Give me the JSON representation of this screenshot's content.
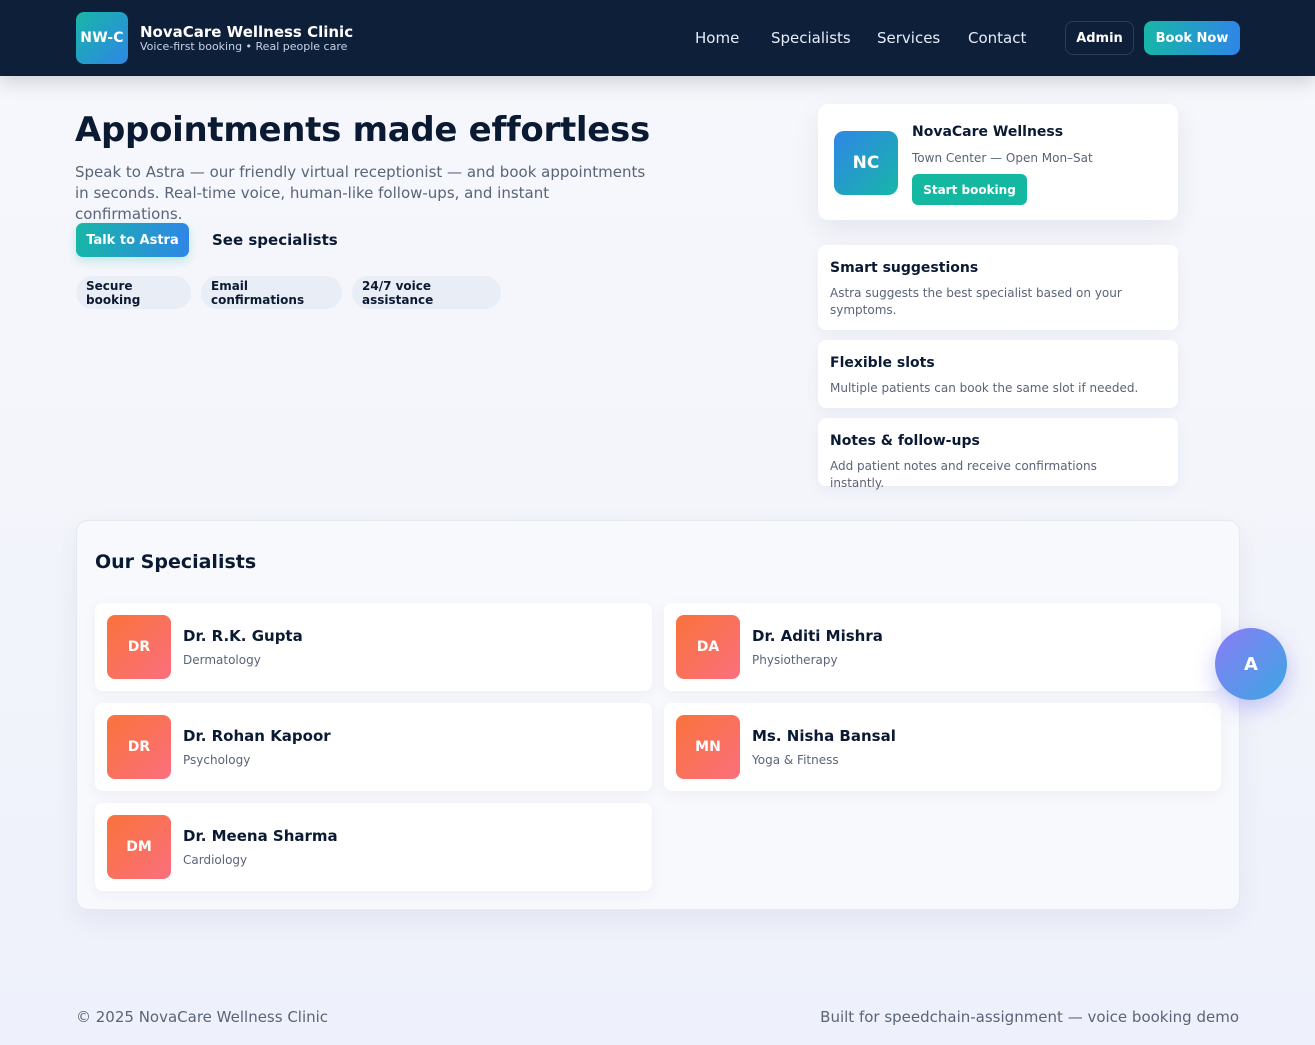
{
  "header": {
    "logo_text": "NW-C",
    "brand_name": "NovaCare Wellness Clinic",
    "brand_tagline": "Voice-first booking • Real people care",
    "nav": [
      "Home",
      "Specialists",
      "Services",
      "Contact"
    ],
    "admin_label": "Admin",
    "book_label": "Book Now"
  },
  "hero": {
    "title": "Appointments made effortless",
    "subtitle": "Speak to Astra — our friendly virtual receptionist — and book appointments in seconds. Real-time voice, human-like follow-ups, and instant confirmations.",
    "talk_label": "Talk to Astra",
    "specialists_link": "See specialists",
    "pills": [
      "Secure booking",
      "Email confirmations",
      "24/7 voice assistance"
    ]
  },
  "clinic_card": {
    "initials": "NC",
    "name": "NovaCare Wellness",
    "location": "Town Center — Open Mon–Sat",
    "start_label": "Start booking"
  },
  "features": [
    {
      "title": "Smart suggestions",
      "desc": "Astra suggests the best specialist based on your symptoms."
    },
    {
      "title": "Flexible slots",
      "desc": "Multiple patients can book the same slot if needed."
    },
    {
      "title": "Notes & follow-ups",
      "desc": "Add patient notes and receive confirmations instantly."
    }
  ],
  "specialists": {
    "heading": "Our Specialists",
    "items": [
      {
        "initials": "DR",
        "name": "Dr. R.K. Gupta",
        "dept": "Dermatology"
      },
      {
        "initials": "DA",
        "name": "Dr. Aditi Mishra",
        "dept": "Physiotherapy"
      },
      {
        "initials": "DR",
        "name": "Dr. Rohan Kapoor",
        "dept": "Psychology"
      },
      {
        "initials": "MN",
        "name": "Ms. Nisha Bansal",
        "dept": "Yoga & Fitness"
      },
      {
        "initials": "DM",
        "name": "Dr. Meena Sharma",
        "dept": "Cardiology"
      }
    ]
  },
  "assistant": {
    "initial": "A"
  },
  "footer": {
    "copyright": "© 2025 NovaCare Wellness Clinic",
    "note": "Built for speedchain-assignment — voice booking demo"
  },
  "colors": {
    "header_bg": "#0e1f3a",
    "accent_teal": "#17b6a8",
    "accent_blue": "#2f86e6",
    "specialist_orange": "#f9733a"
  }
}
